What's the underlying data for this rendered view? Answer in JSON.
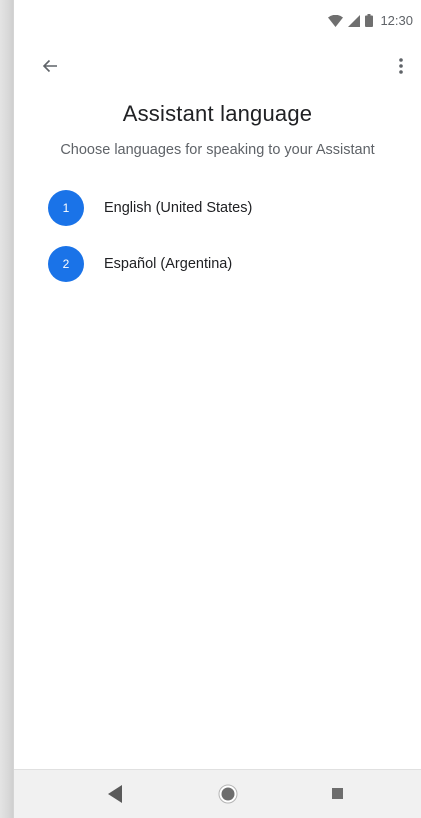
{
  "status_bar": {
    "time": "12:30",
    "icons": [
      "wifi-icon",
      "cell-signal-icon",
      "battery-icon"
    ]
  },
  "app_bar": {
    "back_icon": "arrow-back-icon",
    "menu_icon": "more-vert-icon"
  },
  "page": {
    "title": "Assistant language",
    "subtitle": "Choose languages for speaking to your Assistant"
  },
  "languages": [
    {
      "number": "1",
      "label": "English (United States)"
    },
    {
      "number": "2",
      "label": "Español (Argentina)"
    }
  ],
  "nav_bar": {
    "icons": [
      "nav-back-icon",
      "nav-home-icon",
      "nav-recents-icon"
    ]
  },
  "colors": {
    "accent": "#1a73e8",
    "text_primary": "#202124",
    "text_secondary": "#5f6368",
    "nav_background": "#f1f1f1"
  }
}
